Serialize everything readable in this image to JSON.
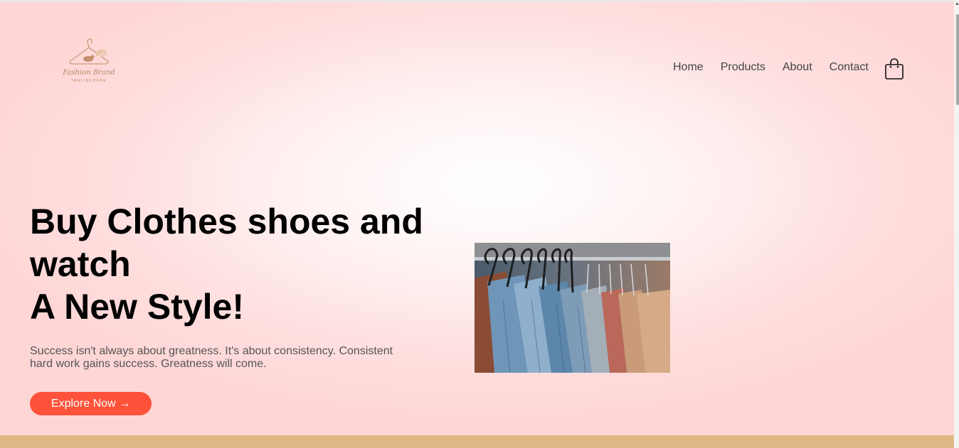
{
  "brand": {
    "name": "Fashion Brand",
    "tagline": "TAGLINEHERE",
    "accent_color": "#ff523b",
    "hero_color": "#ffd6d6",
    "band_color": "#dfb985"
  },
  "nav": {
    "items": [
      "Home",
      "Products",
      "About",
      "Contact"
    ],
    "cart_icon": "shopping-bag-icon"
  },
  "hero": {
    "headline_line1": "Buy Clothes shoes and",
    "headline_line2": "watch",
    "headline_line3": "A New Style!",
    "subtext": "Success isn't always about greatness. It's about consistency. Consistent hard work gains success. Greatness will come.",
    "cta_label": "Explore Now →",
    "image_subject": "denim-jackets-on-hangers"
  }
}
